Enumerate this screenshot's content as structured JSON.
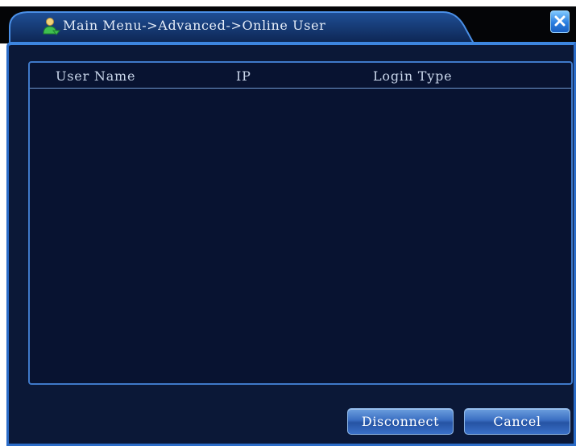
{
  "window": {
    "title": "Main Menu->Advanced->Online User",
    "title_icon": "user-icon",
    "close_icon": "close-icon"
  },
  "table": {
    "columns": [
      "User Name",
      "IP",
      "Login Type"
    ],
    "rows": []
  },
  "buttons": {
    "disconnect_label": "Disconnect",
    "cancel_label": "Cancel"
  },
  "colors": {
    "panel_background": "#0b1837",
    "border_accent": "#2b6cc8",
    "button_blue": "#3a6ec2",
    "text_light": "#c9d6ea"
  }
}
